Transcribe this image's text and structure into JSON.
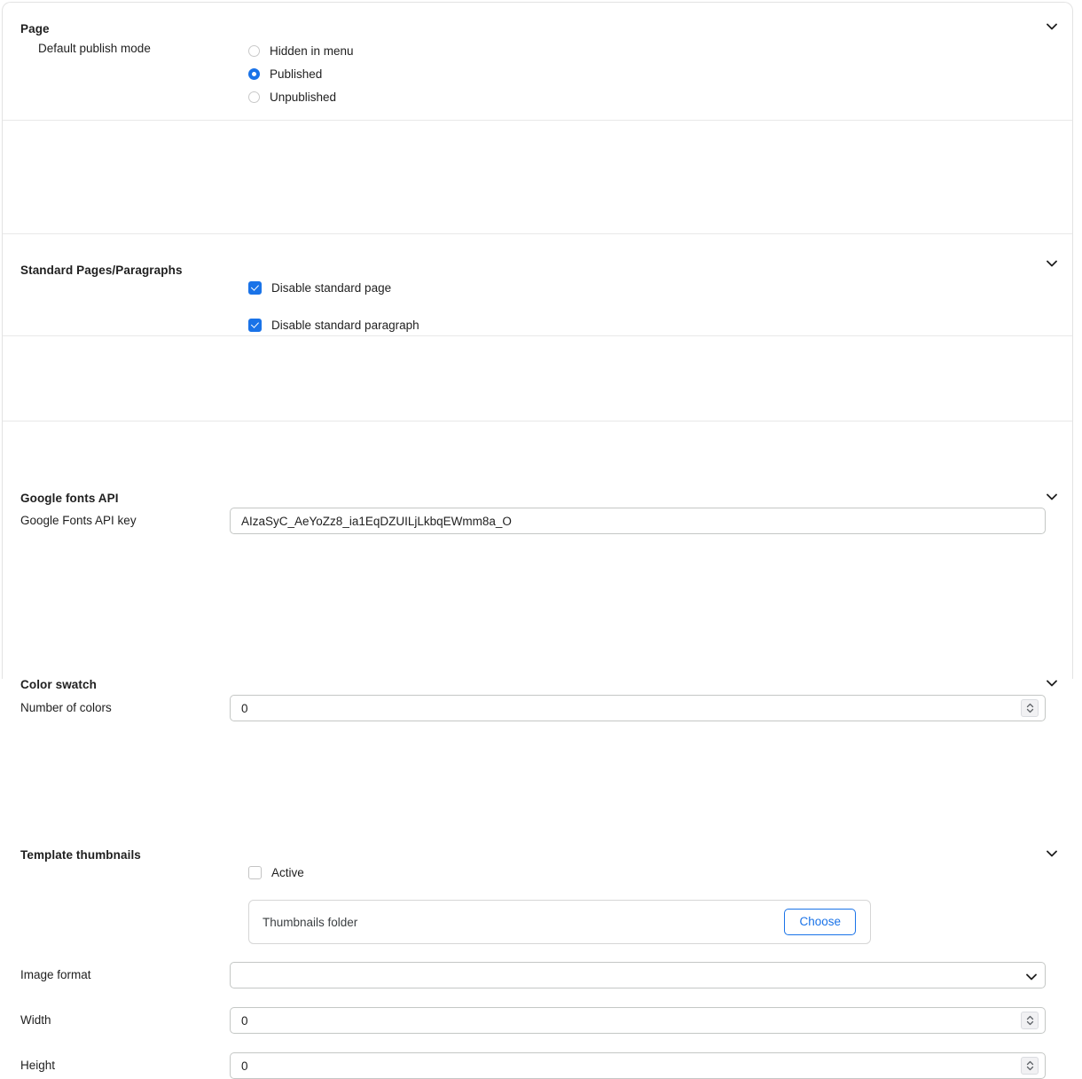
{
  "colors": {
    "accent": "#1a73e8",
    "text": "#1f1f1f",
    "border": "#c4c7c5",
    "card_border": "#e3e3e3"
  },
  "sections": {
    "page": {
      "title": "Page",
      "field_label": "Default publish mode",
      "options": [
        {
          "label": "Hidden in menu",
          "selected": false
        },
        {
          "label": "Published",
          "selected": true
        },
        {
          "label": "Unpublished",
          "selected": false
        }
      ]
    },
    "standard": {
      "title": "Standard Pages/Paragraphs",
      "checkboxes": [
        {
          "label": "Disable standard page",
          "checked": true
        },
        {
          "label": "Disable standard paragraph",
          "checked": true
        }
      ]
    },
    "google_fonts": {
      "title": "Google fonts API",
      "field_label": "Google Fonts API key",
      "api_key_value": "AIzaSyC_AeYoZz8_ia1EqDZUILjLkbqEWmm8a_O"
    },
    "color_swatch": {
      "title": "Color swatch",
      "field_label": "Number of colors",
      "number_of_colors": "0"
    },
    "template_thumbnails": {
      "title": "Template thumbnails",
      "active_label": "Active",
      "active_checked": false,
      "folder_placeholder": "Thumbnails folder",
      "choose_label": "Choose",
      "image_format_label": "Image format",
      "image_format_value": "",
      "width_label": "Width",
      "width_value": "0",
      "height_label": "Height",
      "height_value": "0"
    }
  }
}
